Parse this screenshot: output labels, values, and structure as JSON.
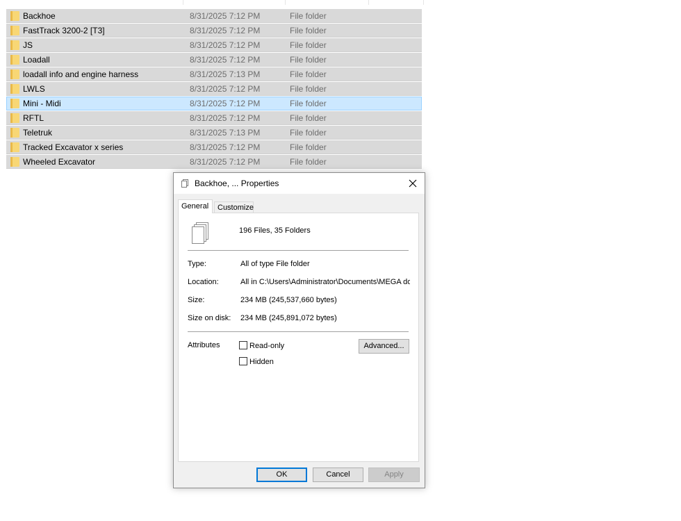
{
  "file_list": [
    {
      "name": "Backhoe",
      "date": "8/31/2025 7:12 PM",
      "type": "File folder"
    },
    {
      "name": "FastTrack 3200-2 [T3]",
      "date": "8/31/2025 7:12 PM",
      "type": "File folder"
    },
    {
      "name": "JS",
      "date": "8/31/2025 7:12 PM",
      "type": "File folder"
    },
    {
      "name": "Loadall",
      "date": "8/31/2025 7:12 PM",
      "type": "File folder"
    },
    {
      "name": "loadall info and engine harness",
      "date": "8/31/2025 7:13 PM",
      "type": "File folder"
    },
    {
      "name": "LWLS",
      "date": "8/31/2025 7:12 PM",
      "type": "File folder"
    },
    {
      "name": "Mini - Midi",
      "date": "8/31/2025 7:12 PM",
      "type": "File folder"
    },
    {
      "name": "RFTL",
      "date": "8/31/2025 7:12 PM",
      "type": "File folder"
    },
    {
      "name": "Teletruk",
      "date": "8/31/2025 7:13 PM",
      "type": "File folder"
    },
    {
      "name": "Tracked Excavator x series",
      "date": "8/31/2025 7:12 PM",
      "type": "File folder"
    },
    {
      "name": "Wheeled Excavator",
      "date": "8/31/2025 7:12 PM",
      "type": "File folder"
    }
  ],
  "dialog": {
    "title": "Backhoe, ... Properties",
    "tabs": [
      "General",
      "Customize"
    ],
    "summary": "196 Files, 35 Folders",
    "type_label": "Type:",
    "type_value": "All of type File folder",
    "location_label": "Location:",
    "location_value": "All in C:\\Users\\Administrator\\Documents\\MEGA dov",
    "size_label": "Size:",
    "size_value": "234 MB (245,537,660 bytes)",
    "size_disk_label": "Size on disk:",
    "size_disk_value": "234 MB (245,891,072 bytes)",
    "attributes_label": "Attributes",
    "readonly_label": "Read-only",
    "hidden_label": "Hidden",
    "advanced_label": "Advanced...",
    "ok_label": "OK",
    "cancel_label": "Cancel",
    "apply_label": "Apply"
  },
  "colors": {
    "selection_bg": "#d9d9d9",
    "focus_bg": "#cce8ff",
    "folder": "#f8d775",
    "accent": "#0078d7"
  }
}
